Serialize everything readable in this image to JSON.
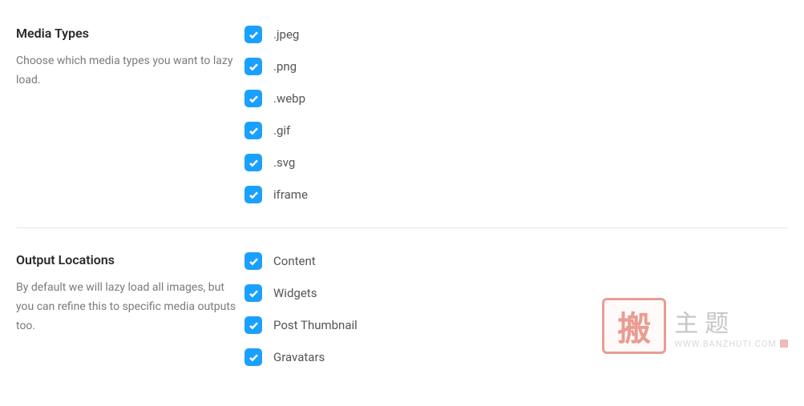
{
  "sections": {
    "media_types": {
      "title": "Media Types",
      "description": "Choose which media types you want to lazy load.",
      "options": {
        "jpeg": ".jpeg",
        "png": ".png",
        "webp": ".webp",
        "gif": ".gif",
        "svg": ".svg",
        "iframe": "iframe"
      }
    },
    "output_locations": {
      "title": "Output Locations",
      "description": "By default we will lazy load all images, but you can refine this to specific media outputs too.",
      "options": {
        "content": "Content",
        "widgets": "Widgets",
        "post_thumbnail": "Post Thumbnail",
        "gravatars": "Gravatars"
      }
    }
  },
  "watermark": {
    "stamp": "搬",
    "title": "主题",
    "url": "WWW.BANZHUTI.COM"
  }
}
